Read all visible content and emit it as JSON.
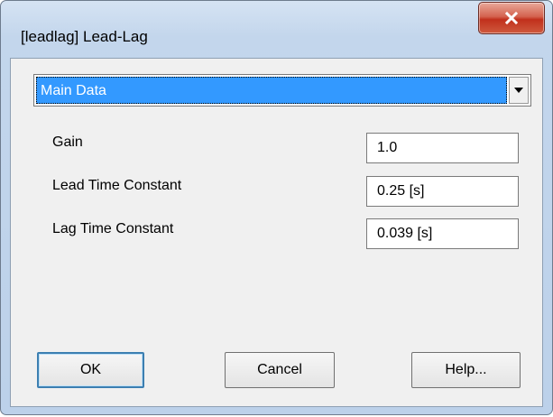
{
  "window": {
    "title": "[leadlag] Lead-Lag",
    "close_icon": "close-icon"
  },
  "page_select": {
    "selected": "Main Data",
    "arrow_icon": "chevron-down-icon"
  },
  "fields": [
    {
      "label": "Gain",
      "value": "1.0"
    },
    {
      "label": "Lead Time Constant",
      "value": "0.25 [s]"
    },
    {
      "label": "Lag Time Constant",
      "value": "0.039 [s]"
    }
  ],
  "buttons": {
    "ok": "OK",
    "cancel": "Cancel",
    "help": "Help..."
  }
}
